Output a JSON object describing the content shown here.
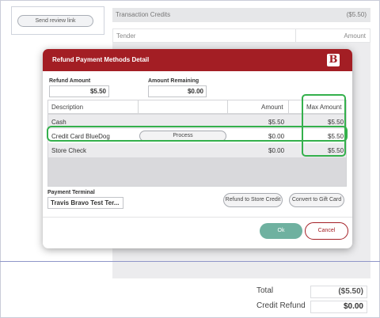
{
  "background": {
    "send_review_link": "Send review link",
    "transaction_credits_label": "Transaction Credits",
    "transaction_credits_value": "($5.50)",
    "tender_label": "Tender",
    "amount_label": "Amount",
    "total_label": "Total",
    "total_value": "($5.50)",
    "credit_refund_label": "Credit Refund",
    "credit_refund_value": "$0.00"
  },
  "modal": {
    "title": "Refund Payment Methods Detail",
    "logo_letter": "B",
    "refund_amount_label": "Refund Amount",
    "refund_amount_value": "$5.50",
    "amount_remaining_label": "Amount Remaining",
    "amount_remaining_value": "$0.00",
    "table": {
      "headers": {
        "description": "Description",
        "amount": "Amount",
        "max_amount": "Max Amount"
      },
      "rows": [
        {
          "description": "Cash",
          "amount": "$5.50",
          "max_amount": "$5.50"
        },
        {
          "description": "Credit Card BlueDog",
          "action": "Process",
          "amount": "$0.00",
          "max_amount": "$5.50"
        },
        {
          "description": "Store Check",
          "amount": "$0.00",
          "max_amount": "$5.50"
        }
      ]
    },
    "payment_terminal_label": "Payment Terminal",
    "payment_terminal_value": "Travis Bravo Test Ter...",
    "refund_to_store_credit": "Refund to Store Credit",
    "convert_to_gift_card": "Convert to Gift Card",
    "ok_label": "Ok",
    "cancel_label": "Cancel"
  },
  "colors": {
    "header_red": "#a31e24",
    "highlight_green": "#34b04c",
    "ok_teal": "#6fb1a0"
  }
}
